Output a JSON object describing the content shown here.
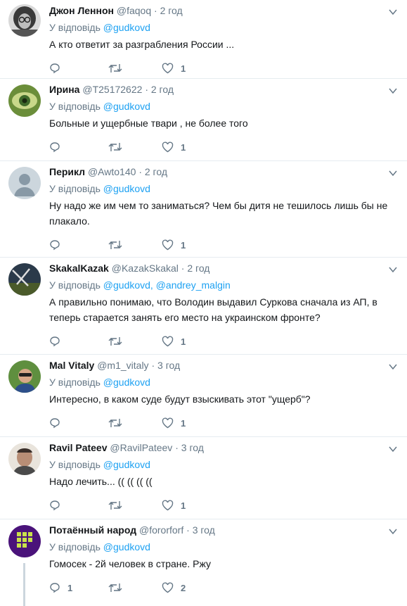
{
  "tweets": [
    {
      "name": "Джон Леннон",
      "handle": "@faqoq",
      "time": "2 год",
      "reply_prefix": "У відповідь",
      "mentions": "@gudkovd",
      "text": "А кто ответит за разграбления России ...",
      "replies": "",
      "retweets": "",
      "likes": "1"
    },
    {
      "name": "Ирина",
      "handle": "@T25172622",
      "time": "2 год",
      "reply_prefix": "У відповідь",
      "mentions": "@gudkovd",
      "text": "Больные и ущербные твари , не более того",
      "replies": "",
      "retweets": "",
      "likes": "1"
    },
    {
      "name": "Перикл",
      "handle": "@Awto140",
      "time": "2 год",
      "reply_prefix": "У відповідь",
      "mentions": "@gudkovd",
      "text": "Ну надо же им чем то заниматься? Чем бы дитя не тешилось лишь бы не плакало.",
      "replies": "",
      "retweets": "",
      "likes": "1"
    },
    {
      "name": "SkakalKazak",
      "handle": "@KazakSkakal",
      "time": "2 год",
      "reply_prefix": "У відповідь",
      "mentions": "@gudkovd, @andrey_malgin",
      "text": "А правильно понимаю, что Володин выдавил Суркова сначала из АП, в теперь старается занять его место на украинском фронте?",
      "replies": "",
      "retweets": "",
      "likes": "1"
    },
    {
      "name": "Mal Vitaly",
      "handle": "@m1_vitaly",
      "time": "3 год",
      "reply_prefix": "У відповідь",
      "mentions": "@gudkovd",
      "text": "Интересно, в каком суде будут взыскивать этот \"ущерб\"?",
      "replies": "",
      "retweets": "",
      "likes": "1"
    },
    {
      "name": "Ravil Pateev",
      "handle": "@RavilPateev",
      "time": "3 год",
      "reply_prefix": "У відповідь",
      "mentions": "@gudkovd",
      "text": "Надо лечить... (( (( (( ((",
      "replies": "",
      "retweets": "",
      "likes": "1"
    },
    {
      "name": "Потаённый народ",
      "handle": "@fororforf",
      "time": "3 год",
      "reply_prefix": "У відповідь",
      "mentions": "@gudkovd",
      "text": "Гомосек - 2й человек в стране. Ржу",
      "replies": "1",
      "retweets": "",
      "likes": "2"
    }
  ],
  "dot": "·",
  "colors": {
    "accent": "#1da1f2",
    "muted": "#657786",
    "border": "#e6ecf0"
  }
}
